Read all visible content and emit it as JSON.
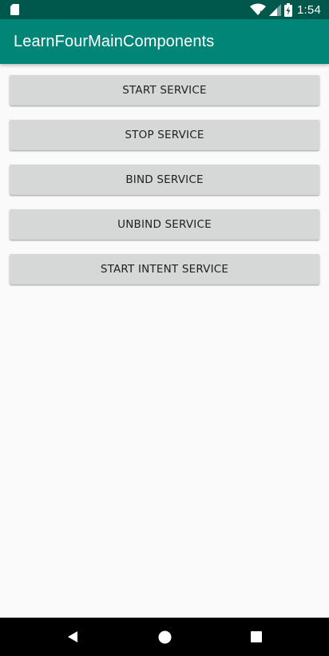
{
  "status_bar": {
    "time": "1:54",
    "icons": [
      "sd-card-icon",
      "wifi-icon",
      "signal-icon",
      "battery-charging-icon"
    ]
  },
  "app_bar": {
    "title": "LearnFourMainComponents"
  },
  "buttons": [
    {
      "label": "START SERVICE"
    },
    {
      "label": "STOP SERVICE"
    },
    {
      "label": "BIND SERVICE"
    },
    {
      "label": "UNBIND SERVICE"
    },
    {
      "label": "START INTENT SERVICE"
    }
  ],
  "nav_bar": {
    "icons": [
      "back-icon",
      "home-icon",
      "recents-icon"
    ]
  },
  "colors": {
    "status_bar": "#00574b",
    "app_bar": "#008577",
    "button_bg": "#d6d7d7",
    "background": "#fafafa"
  }
}
